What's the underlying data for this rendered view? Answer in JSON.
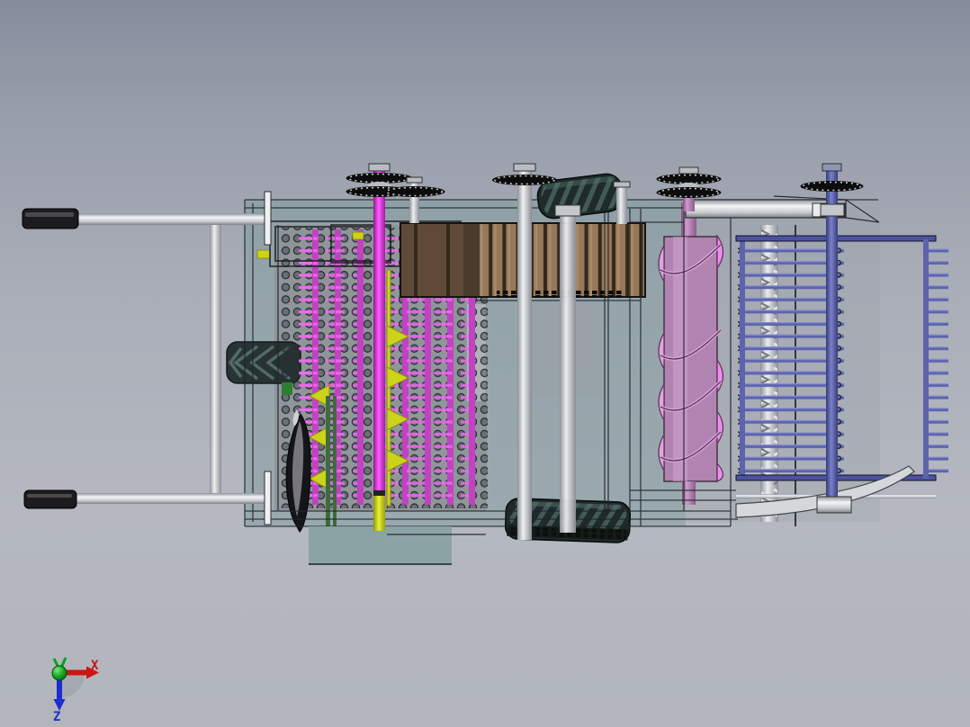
{
  "scene": {
    "description": "3D CAD top view of a hand-guided harvester machine",
    "background_top": "#868c9b",
    "background_bottom": "#b2b5bc"
  },
  "axis_triad": {
    "x_label": "X",
    "z_label": "Z",
    "x_color": "#cc1414",
    "y_color": "#0d9e1f",
    "z_color": "#1a2fd0",
    "shadow_color": "#9aa0a8"
  },
  "colors": {
    "outline": "#1d2126",
    "housing_teal": "#7d9a9c",
    "panel_gray": "#8e9397",
    "plate_gray": "#b0b3b7",
    "bottom_plate_teal": "#87a1a2",
    "grip_black": "#1c1c1f",
    "silver": "#d8dadd",
    "magenta_shaft": "#cc2fcc",
    "magenta_column": "#c341c3",
    "pink_pin": "#ee6bee",
    "perf_hole": "#2b3036",
    "yellow_part": "#ccd31a",
    "green_bar": "#3f6b3c",
    "conveyor_slat": "#97785a",
    "conveyor_dark": "#5f4a39",
    "conveyor_divider": "#4b3b2d",
    "auger_body": "#b183b1",
    "auger_flight": "#e0a4e0",
    "auger_flight_bright": "#ee8dee",
    "blue_part": "#5d63ad",
    "blue_rail": "#4d529e",
    "tire": "#1e2b29",
    "tread": "#4a6360",
    "sprocket": "#0d0d0d",
    "deck_blade": "#d5d8db"
  }
}
